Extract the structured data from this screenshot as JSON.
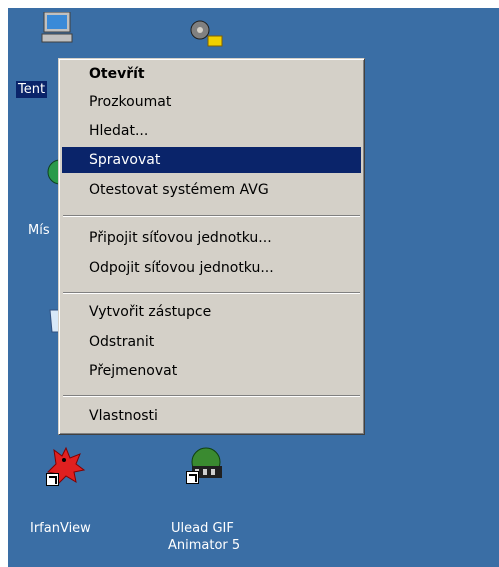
{
  "desktop": {
    "background": "#3a6ea5",
    "icons": {
      "my_computer": {
        "label": "Tent",
        "icon": "computer-icon"
      },
      "network": {
        "label": "Mís",
        "icon": "network-places-icon"
      },
      "recycle": {
        "label": "",
        "icon": "recycle-bin-icon"
      },
      "settings": {
        "label": "",
        "icon": "gear-icon"
      },
      "irfanview": {
        "label": "IrfanView",
        "icon": "irfanview-icon"
      },
      "ulead": {
        "label_line1": "Ulead GIF",
        "label_line2": "Animator 5",
        "icon": "ulead-gif-animator-icon"
      }
    }
  },
  "context_menu": {
    "highlight_color": "#0a246a",
    "items": [
      {
        "label": "Otevřít",
        "bold": true
      },
      {
        "label": "Prozkoumat"
      },
      {
        "label": "Hledat..."
      },
      {
        "label": "Spravovat",
        "highlighted": true
      },
      {
        "label": "Otestovat systémem AVG"
      },
      {
        "label": "Připojit síťovou jednotku..."
      },
      {
        "label": "Odpojit síťovou jednotku..."
      },
      {
        "label": "Vytvořit zástupce"
      },
      {
        "label": "Odstranit"
      },
      {
        "label": "Přejmenovat"
      },
      {
        "label": "Vlastnosti"
      }
    ]
  }
}
